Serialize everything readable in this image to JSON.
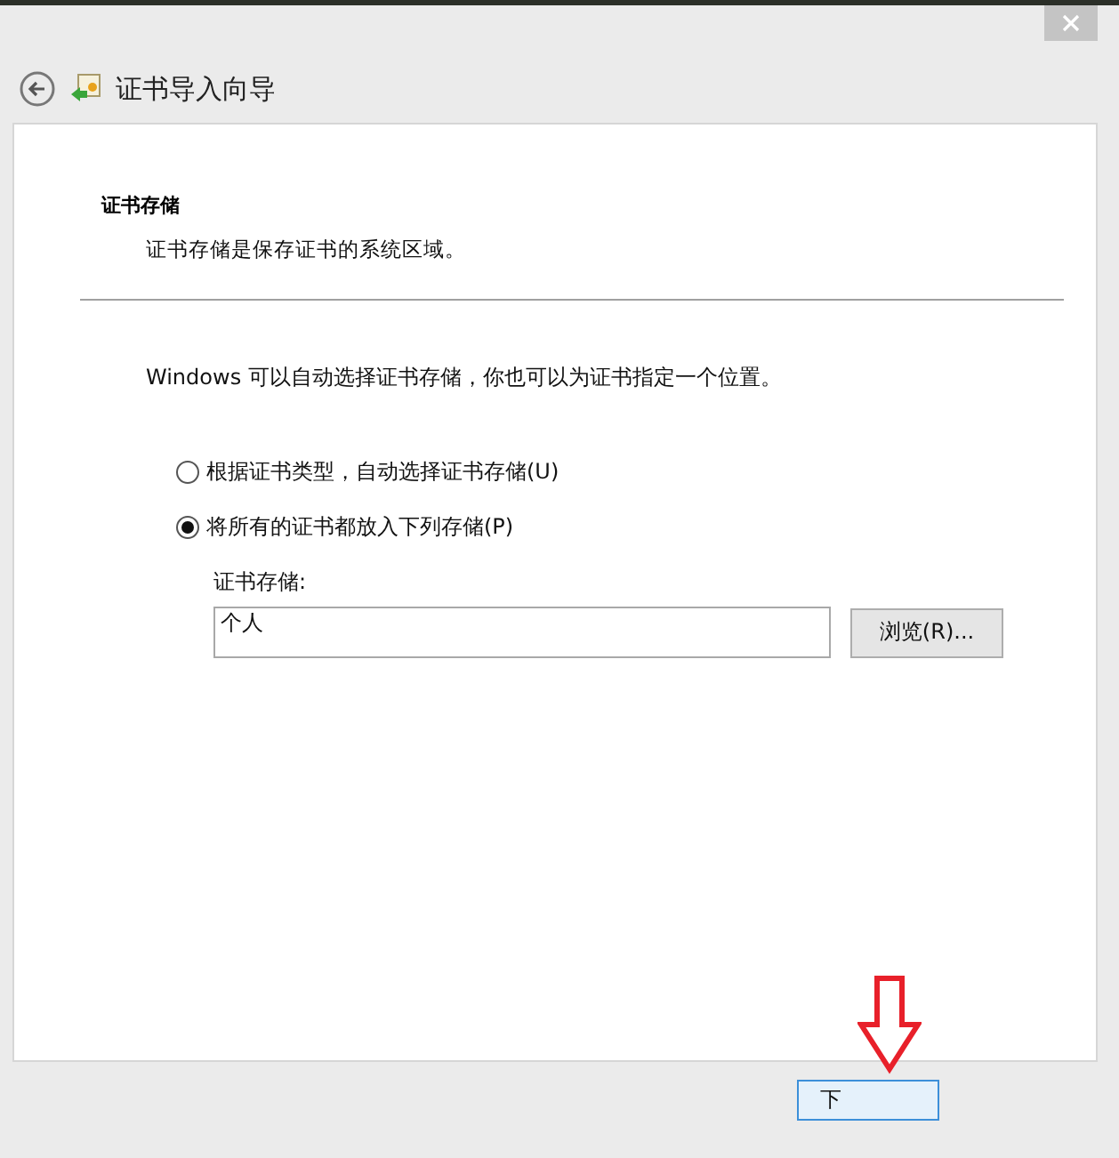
{
  "window": {
    "title": "证书导入向导"
  },
  "section": {
    "heading": "证书存储",
    "description": "证书存储是保存证书的系统区域。"
  },
  "intro": "Windows 可以自动选择证书存储，你也可以为证书指定一个位置。",
  "options": [
    {
      "label": "根据证书类型，自动选择证书存储(U)",
      "selected": false
    },
    {
      "label": "将所有的证书都放入下列存储(P)",
      "selected": true
    }
  ],
  "store": {
    "label": "证书存储:",
    "value": "个人",
    "browse": "浏览(R)..."
  },
  "footer": {
    "next": "下"
  }
}
